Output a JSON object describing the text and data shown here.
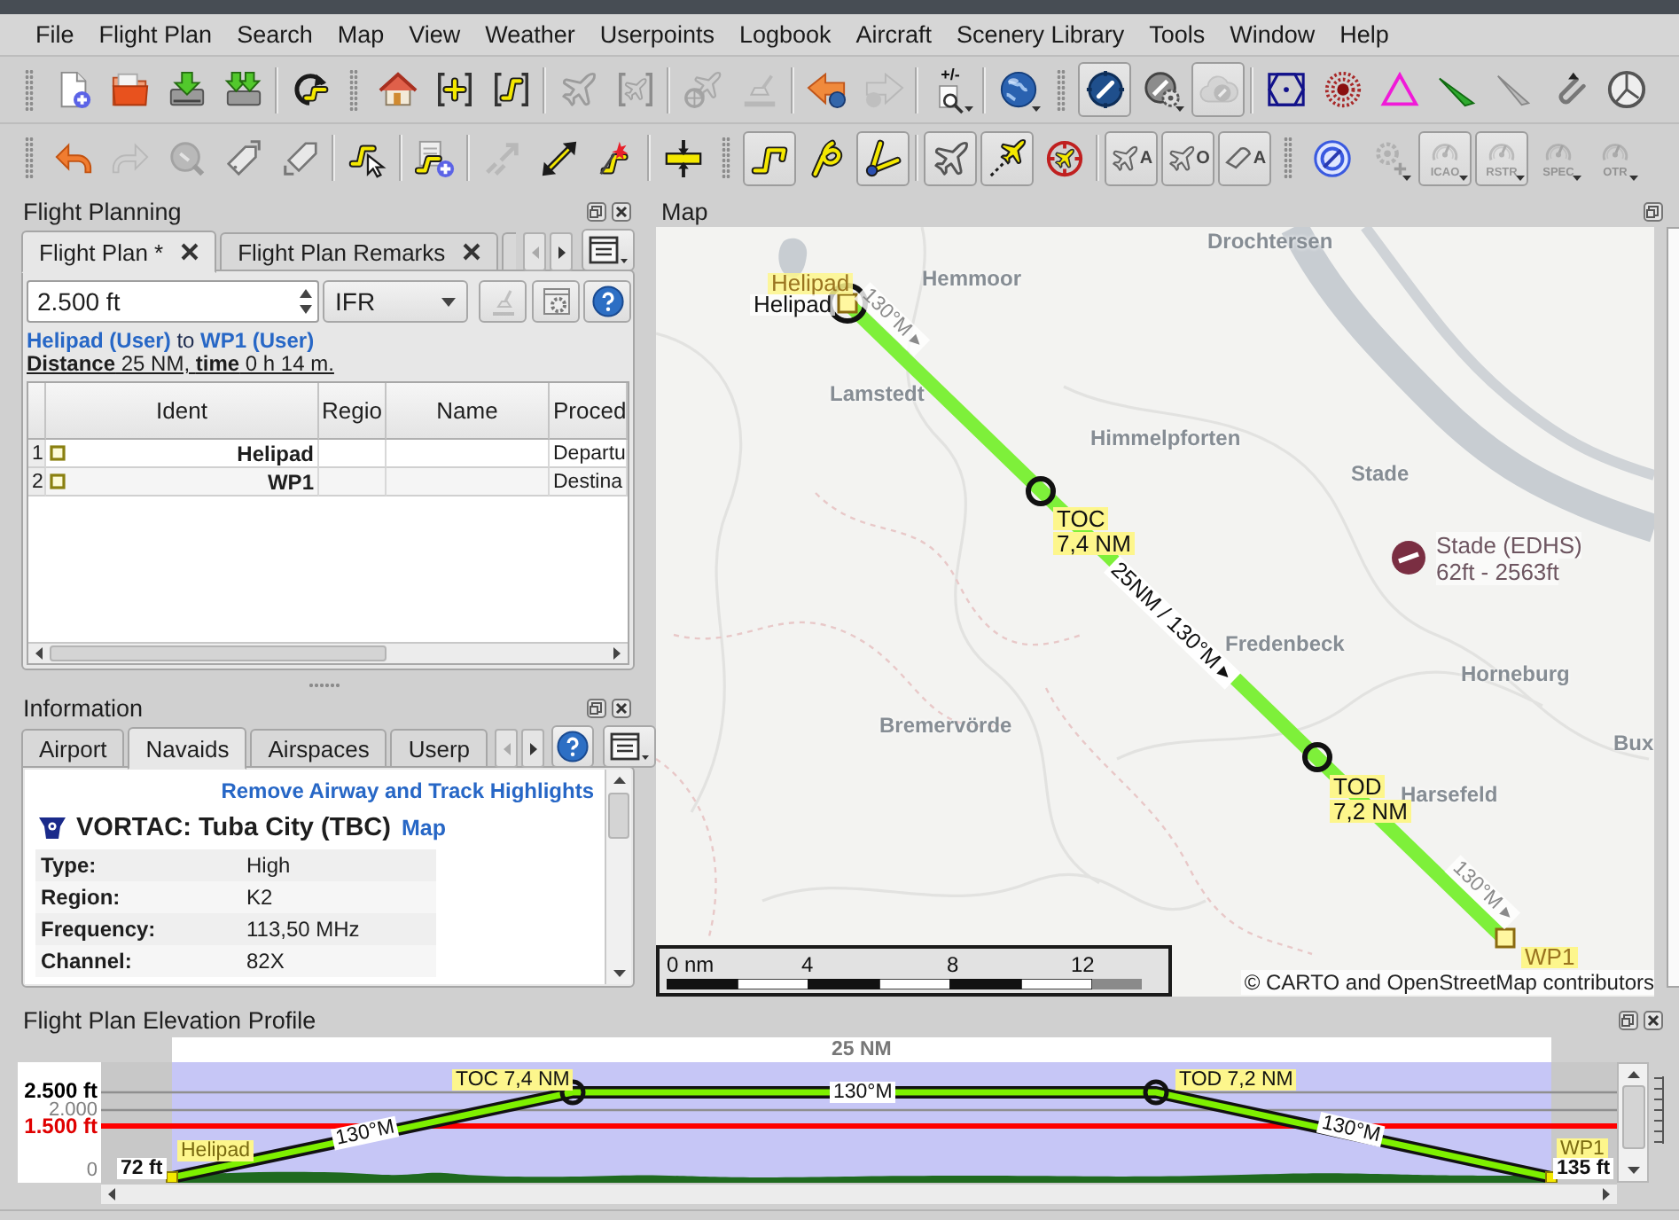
{
  "menu": [
    "File",
    "Flight Plan",
    "Search",
    "Map",
    "View",
    "Weather",
    "Userpoints",
    "Logbook",
    "Aircraft",
    "Scenery Library",
    "Tools",
    "Window",
    "Help"
  ],
  "toolbars": [
    [
      {
        "kind": "grip"
      },
      {
        "kind": "new-file",
        "pressed": false,
        "disabled": false,
        "dropdown": false
      },
      {
        "kind": "open-folder",
        "pressed": false,
        "disabled": false,
        "dropdown": false
      },
      {
        "kind": "save",
        "pressed": false,
        "disabled": false,
        "dropdown": false
      },
      {
        "kind": "save-as",
        "pressed": false,
        "disabled": false,
        "dropdown": false
      },
      {
        "kind": "separator"
      },
      {
        "kind": "reload-route",
        "pressed": false,
        "disabled": false,
        "dropdown": false
      },
      {
        "kind": "grip"
      },
      {
        "kind": "home",
        "pressed": false,
        "disabled": false,
        "dropdown": false
      },
      {
        "kind": "center-plus",
        "pressed": false,
        "disabled": false,
        "dropdown": false
      },
      {
        "kind": "center-route",
        "pressed": false,
        "disabled": false,
        "dropdown": false
      },
      {
        "kind": "separator"
      },
      {
        "kind": "airplane",
        "pressed": false,
        "disabled": true,
        "dropdown": false
      },
      {
        "kind": "center-airplane",
        "pressed": false,
        "disabled": true,
        "dropdown": false
      },
      {
        "kind": "separator"
      },
      {
        "kind": "airplane-target",
        "pressed": false,
        "disabled": true,
        "dropdown": false
      },
      {
        "kind": "eraser",
        "pressed": false,
        "disabled": true,
        "dropdown": false
      },
      {
        "kind": "separator"
      },
      {
        "kind": "back",
        "pressed": false,
        "disabled": false,
        "dropdown": false
      },
      {
        "kind": "forward",
        "pressed": false,
        "disabled": true,
        "dropdown": false
      },
      {
        "kind": "separator"
      },
      {
        "kind": "zoom",
        "label": "+/-",
        "pressed": false,
        "disabled": false,
        "dropdown": true
      },
      {
        "kind": "separator"
      },
      {
        "kind": "globe",
        "pressed": false,
        "disabled": false,
        "dropdown": true
      },
      {
        "kind": "grip"
      },
      {
        "kind": "compass",
        "pressed": true,
        "disabled": false,
        "dropdown": false
      },
      {
        "kind": "compass-gear",
        "pressed": false,
        "disabled": false,
        "dropdown": true
      },
      {
        "kind": "cloud",
        "pressed": true,
        "disabled": true,
        "dropdown": false
      },
      {
        "kind": "separator"
      },
      {
        "kind": "hexagon",
        "pressed": false,
        "disabled": false,
        "dropdown": false
      },
      {
        "kind": "dotted-circle",
        "pressed": false,
        "disabled": false,
        "dropdown": false
      },
      {
        "kind": "triangle",
        "pressed": false,
        "disabled": false,
        "dropdown": false
      },
      {
        "kind": "feather-airway",
        "pressed": false,
        "disabled": false,
        "dropdown": false
      },
      {
        "kind": "feather-track",
        "pressed": false,
        "disabled": false,
        "dropdown": false
      },
      {
        "kind": "clip",
        "pressed": false,
        "disabled": false,
        "dropdown": false
      },
      {
        "kind": "clock",
        "pressed": false,
        "disabled": false,
        "dropdown": false
      }
    ],
    [
      {
        "kind": "grip"
      },
      {
        "kind": "undo",
        "pressed": false,
        "disabled": false,
        "dropdown": false
      },
      {
        "kind": "redo",
        "pressed": false,
        "disabled": true,
        "dropdown": false
      },
      {
        "kind": "dial",
        "pressed": false,
        "disabled": true,
        "dropdown": false
      },
      {
        "kind": "tag-up",
        "pressed": false,
        "disabled": false,
        "dropdown": false
      },
      {
        "kind": "tag-down",
        "pressed": false,
        "disabled": false,
        "dropdown": false
      },
      {
        "kind": "separator"
      },
      {
        "kind": "route-cursor",
        "pressed": false,
        "disabled": false,
        "dropdown": false
      },
      {
        "kind": "separator"
      },
      {
        "kind": "route-add",
        "pressed": false,
        "disabled": false,
        "dropdown": false
      },
      {
        "kind": "separator"
      },
      {
        "kind": "swap-arrows",
        "pressed": false,
        "disabled": true,
        "dropdown": false
      },
      {
        "kind": "double-arrow",
        "pressed": false,
        "disabled": false,
        "dropdown": false
      },
      {
        "kind": "magic-wand",
        "pressed": false,
        "disabled": false,
        "dropdown": false
      },
      {
        "kind": "separator"
      },
      {
        "kind": "vertical-move",
        "pressed": false,
        "disabled": false,
        "dropdown": false
      },
      {
        "kind": "grip"
      },
      {
        "kind": "route",
        "pressed": true,
        "disabled": false,
        "dropdown": false
      },
      {
        "kind": "route-pin",
        "pressed": false,
        "disabled": false,
        "dropdown": false
      },
      {
        "kind": "compass-lines",
        "pressed": true,
        "disabled": false,
        "dropdown": false
      },
      {
        "kind": "separator"
      },
      {
        "kind": "airplane",
        "pressed": true,
        "disabled": false,
        "dropdown": false
      },
      {
        "kind": "airplane-track",
        "pressed": true,
        "disabled": false,
        "dropdown": false
      },
      {
        "kind": "airplane-circle",
        "pressed": false,
        "disabled": false,
        "dropdown": false
      },
      {
        "kind": "separator"
      },
      {
        "kind": "airplane-letter",
        "label": "A",
        "pressed": true,
        "disabled": false,
        "dropdown": false
      },
      {
        "kind": "airplane-letter",
        "label": "O",
        "pressed": true,
        "disabled": false,
        "dropdown": false
      },
      {
        "kind": "ship-letter",
        "label": "A",
        "pressed": true,
        "disabled": false,
        "dropdown": false
      },
      {
        "kind": "grip"
      },
      {
        "kind": "compass-ring",
        "pressed": false,
        "disabled": false,
        "dropdown": false
      },
      {
        "kind": "gear-plus",
        "pressed": false,
        "disabled": true,
        "dropdown": true
      },
      {
        "kind": "gauge",
        "label": "ICAO",
        "pressed": true,
        "disabled": true,
        "dropdown": true
      },
      {
        "kind": "gauge",
        "label": "RSTR",
        "pressed": true,
        "disabled": true,
        "dropdown": true
      },
      {
        "kind": "gauge",
        "label": "SPEC",
        "pressed": false,
        "disabled": true,
        "dropdown": true
      },
      {
        "kind": "gauge",
        "label": "OTR",
        "pressed": false,
        "disabled": true,
        "dropdown": true
      }
    ]
  ],
  "flight_planning": {
    "title": "Flight Planning",
    "tabs": [
      {
        "label": "Flight Plan *",
        "selected": true
      },
      {
        "label": "Flight Plan Remarks",
        "selected": false
      }
    ],
    "altitude": "2.500 ft",
    "flight_rules": "IFR",
    "buttons": [
      {
        "kind": "clear",
        "disabled": true
      },
      {
        "kind": "settings",
        "disabled": false
      },
      {
        "kind": "help",
        "disabled": false
      }
    ],
    "route_summary": "**Helipad (User)** to **WP1 (User)**",
    "distance_summary": "**Distance** 25 NM, **time** 0 h 14 m.",
    "table": {
      "columns": [
        "Ident",
        "Regio",
        "Name",
        "Proced"
      ],
      "rows": [
        {
          "number": "1",
          "ident": "Helipad",
          "procedure": "Departu"
        },
        {
          "number": "2",
          "ident": "WP1",
          "procedure": "Destina"
        }
      ]
    }
  },
  "information": {
    "title": "Information",
    "tabs": [
      {
        "label": "Airport",
        "selected": false
      },
      {
        "label": "Navaids",
        "selected": true
      },
      {
        "label": "Airspaces",
        "selected": false
      },
      {
        "label": "Userp",
        "selected": false
      }
    ],
    "link": "Remove Airway and Track Highlights",
    "navaid": {
      "name": "VORTAC: Tuba City (TBC)",
      "link": "Map"
    },
    "fields": [
      {
        "label": "Type:",
        "value": "High"
      },
      {
        "label": "Region:",
        "value": "K2"
      },
      {
        "label": "Frequency:",
        "value": "113,50 MHz"
      },
      {
        "label": "Channel:",
        "value": "82X"
      }
    ]
  },
  "map": {
    "title": "Map",
    "places": [
      "Drochtersen",
      "Hemmoor",
      "Lamstedt",
      "Himmelpforten",
      "Stade",
      "Fredenbeck",
      "Horneburg",
      "Bremervörde",
      "Harsefeld",
      "Bux"
    ],
    "route": {
      "departure": {
        "label": "Helipad",
        "name": "Helipad"
      },
      "toc": {
        "label": "TOC",
        "distance": "7,4 NM"
      },
      "tod": {
        "label": "TOD",
        "distance": "7,2 NM"
      },
      "destination": {
        "label": "WP1"
      },
      "legs": [
        "130°M ▸",
        "25NM / 130°M ▸",
        "130°M ▸"
      ]
    },
    "airport": {
      "name": "Stade (EDHS)",
      "elevation": "62ft - 2563ft"
    },
    "scale": [
      "0 nm",
      "4",
      "8",
      "12"
    ],
    "attribution": "© CARTO and OpenStreetMap contributors"
  },
  "elevation_profile": {
    "title": "Flight Plan Elevation Profile",
    "total_distance": "25 NM",
    "axis": [
      {
        "label": "2.500 ft",
        "kind": "cruise"
      },
      {
        "label": "2.000",
        "kind": "grid"
      },
      {
        "label": "1.500 ft",
        "kind": "safe"
      },
      {
        "label": "0",
        "kind": "grid"
      }
    ],
    "departure": {
      "label": "Helipad",
      "elevation": "72 ft"
    },
    "toc": "TOC 7,4 NM",
    "tod": "TOD 7,2 NM",
    "legs": [
      "130°M",
      "130°M",
      "130°M"
    ],
    "destination": {
      "label": "WP1",
      "elevation": "135 ft"
    }
  }
}
